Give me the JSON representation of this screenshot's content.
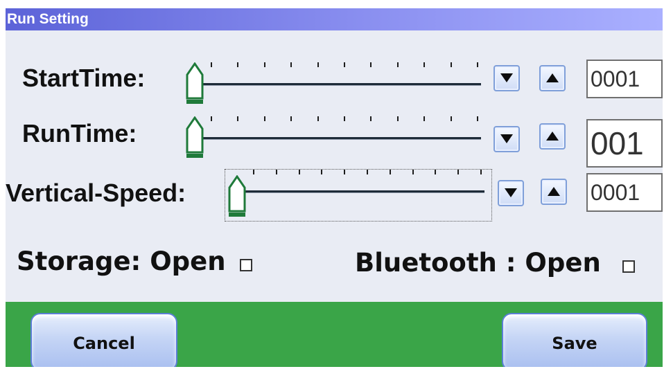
{
  "window": {
    "title": "Run Setting"
  },
  "rows": [
    {
      "label": "StartTime:",
      "value": "0001",
      "slider_level": 0
    },
    {
      "label": "RunTime:",
      "value": "001",
      "slider_level": 0
    },
    {
      "label": "Vertical-Speed:",
      "value": "0001",
      "slider_level": 0
    }
  ],
  "options": {
    "storage": "Storage: Open",
    "bluetooth": "Bluetooth : Open"
  },
  "buttons": {
    "cancel": "Cancel",
    "save": "Save"
  },
  "colors": {
    "title_bar": "#5c63d8",
    "footer": "#3aa548",
    "thumb": "#1f7a3a",
    "button_border": "#5b7fd6"
  }
}
